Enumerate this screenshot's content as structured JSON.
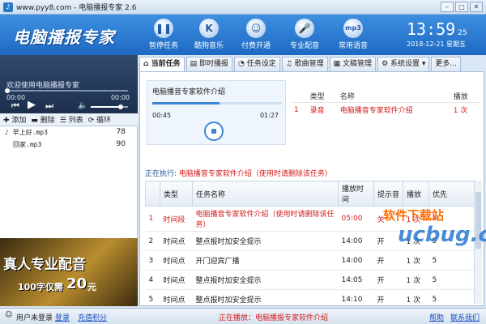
{
  "window": {
    "title": "www.pyy8.com - 电脑播报专家 2.6"
  },
  "header": {
    "logo": "电脑播报专家",
    "tools": [
      {
        "label": "暂停任务",
        "icon": "pause-icon"
      },
      {
        "label": "酷狗音乐",
        "icon": "kugou-icon"
      },
      {
        "label": "付费开通",
        "icon": "user-icon"
      },
      {
        "label": "专业配音",
        "icon": "microphone-icon"
      },
      {
        "label": "常用语音",
        "icon": "mp3-icon"
      }
    ],
    "clock": {
      "time": "13:59",
      "seconds": "25",
      "date": "2018-12-21  星期五"
    }
  },
  "player": {
    "welcome": "欢迎使用电脑播报专家",
    "current": "00:00",
    "total": "00:00",
    "progress": 0,
    "volume": 0.8
  },
  "playlist": {
    "toolbar": [
      "添加",
      "删除",
      "列表",
      "循环"
    ],
    "items": [
      {
        "name": "早上好.mp3",
        "duration": "78"
      },
      {
        "name": "回家.mp3",
        "duration": "90"
      }
    ]
  },
  "ad": {
    "headline": "真人专业配音",
    "sub": "100字仅需",
    "price": "20",
    "unit": "元"
  },
  "tabs": [
    "当前任务",
    "即时播报",
    "任务设定",
    "歌曲管理",
    "文稿管理",
    "系统设置",
    "更多..."
  ],
  "preview": {
    "name": "电脑播音专家软件介绍",
    "elapsed": "00:45",
    "total": "01:27",
    "progress": 0.52
  },
  "side_table": {
    "headers": [
      "",
      "类型",
      "名称",
      "播放"
    ],
    "rows": [
      {
        "idx": "1",
        "type": "录音",
        "name": "电脑播音专家软件介绍",
        "plays": "1 次"
      }
    ]
  },
  "running": {
    "label": "正在执行:",
    "value": "电脑播音专家软件介绍（使用时请删除该任务）"
  },
  "task_list": {
    "headers": [
      "",
      "类型",
      "任务名称",
      "播放时间",
      "提示音",
      "播放",
      "优先"
    ],
    "rows": [
      {
        "idx": "1",
        "type": "时间段",
        "name": "电脑播音专家软件介绍（使用时请删除该任务）",
        "time": "05:00",
        "tone": "关",
        "plays": "1 次",
        "prio": "5",
        "hl": true
      },
      {
        "idx": "2",
        "type": "时间点",
        "name": "整点报时加安全提示",
        "time": "14:00",
        "tone": "开",
        "plays": "1 次",
        "prio": "5",
        "hl": false
      },
      {
        "idx": "3",
        "type": "时间点",
        "name": "开门迎宾广播",
        "time": "14:00",
        "tone": "开",
        "plays": "1 次",
        "prio": "5",
        "hl": false
      },
      {
        "idx": "4",
        "type": "时间点",
        "name": "整点报时加安全提示",
        "time": "14:05",
        "tone": "开",
        "plays": "1 次",
        "prio": "5",
        "hl": false
      },
      {
        "idx": "5",
        "type": "时间点",
        "name": "整点报时加安全提示",
        "time": "14:10",
        "tone": "开",
        "plays": "1 次",
        "prio": "5",
        "hl": false
      },
      {
        "idx": "6",
        "type": "时间点",
        "name": "整点报时加安全提示",
        "time": "14:15",
        "tone": "开",
        "plays": "1 次",
        "prio": "5",
        "hl": false
      }
    ]
  },
  "watermark": {
    "line1": "软件下载站",
    "line2": "ucbug.cc"
  },
  "status": {
    "user": "用户未登录",
    "login": "登录",
    "recharge": "充值积分",
    "playing": "正在播放：电脑播报专家软件介绍",
    "help": "帮助",
    "contact": "联系我们"
  },
  "colors": {
    "header": "#1e69c3",
    "highlight": "#d31c1c",
    "link": "#1a4fbf"
  }
}
